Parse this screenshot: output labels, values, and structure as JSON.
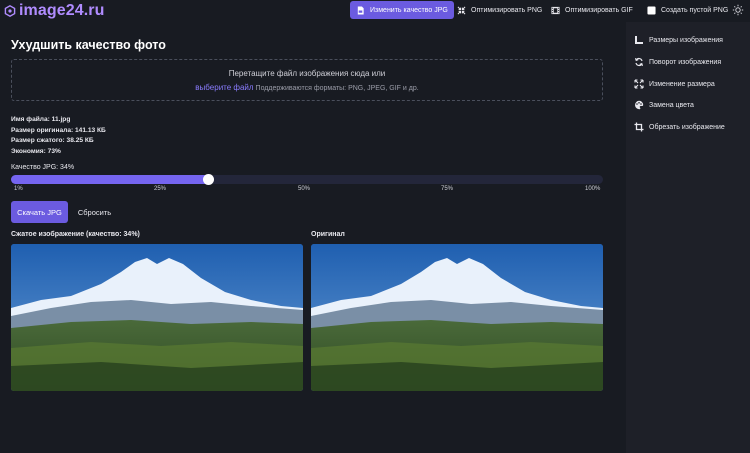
{
  "app": {
    "logo_text": "image24.ru",
    "brand_color": "#b08cff",
    "accent_color": "#6b5be0"
  },
  "nav": {
    "items": [
      {
        "label": "Изменить качество JPG",
        "icon": "file-jpg-icon",
        "active": true
      },
      {
        "label": "Оптимизировать PNG",
        "icon": "compress-arrows-icon",
        "active": false
      },
      {
        "label": "Оптимизировать GIF",
        "icon": "film-icon",
        "active": false
      },
      {
        "label": "Создать пустой PNG",
        "icon": "blank-square-icon",
        "active": false
      }
    ],
    "theme_icon": "sun-icon"
  },
  "main": {
    "title": "Ухудшить качество фото",
    "dropzone": {
      "line1": "Перетащите файл изображения сюда или",
      "link": "выберите файл",
      "formats": "Поддерживаются форматы: PNG, JPEG, GIF и др."
    },
    "info": {
      "filename": "Имя файла: 11.jpg",
      "original_size": "Размер оригинала: 141.13 КБ",
      "compressed_size": "Размер сжатого: 38.25 КБ",
      "savings": "Экономия: 73%"
    },
    "quality": {
      "label": "Качество JPG: 34%",
      "value": 34,
      "ticks": [
        "1%",
        "25%",
        "50%",
        "75%",
        "100%"
      ]
    },
    "buttons": {
      "download": "Скачать JPG",
      "reset": "Сбросить"
    },
    "compressed_caption": "Сжатое изображение (качество: 34%)",
    "original_caption": "Оригинал"
  },
  "sidebar": {
    "items": [
      {
        "label": "Размеры изображения",
        "icon": "ruler-corner-icon"
      },
      {
        "label": "Поворот изображения",
        "icon": "rotate-icon"
      },
      {
        "label": "Изменение размера",
        "icon": "resize-arrows-icon"
      },
      {
        "label": "Замена цвета",
        "icon": "palette-icon"
      },
      {
        "label": "Обрезать изображение",
        "icon": "crop-icon"
      }
    ]
  }
}
